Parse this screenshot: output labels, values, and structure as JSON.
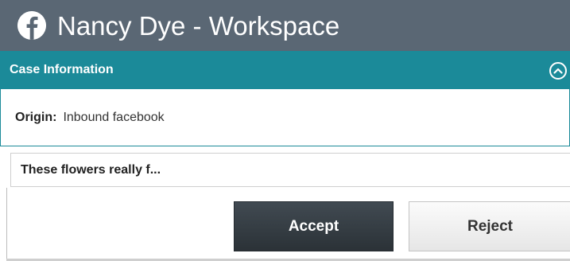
{
  "window": {
    "title": "Nancy Dye - Workspace",
    "icon": "facebook-icon"
  },
  "case_info": {
    "header": "Case Information",
    "collapse_icon": "chevron-up-circle-icon",
    "origin_label": "Origin:",
    "origin_value": "Inbound facebook"
  },
  "message": {
    "preview": "These flowers really f..."
  },
  "actions": {
    "accept_label": "Accept",
    "reject_label": "Reject"
  },
  "colors": {
    "titlebar": "#5a6774",
    "accent": "#1b8a99",
    "accept_button": "#2f373d"
  }
}
